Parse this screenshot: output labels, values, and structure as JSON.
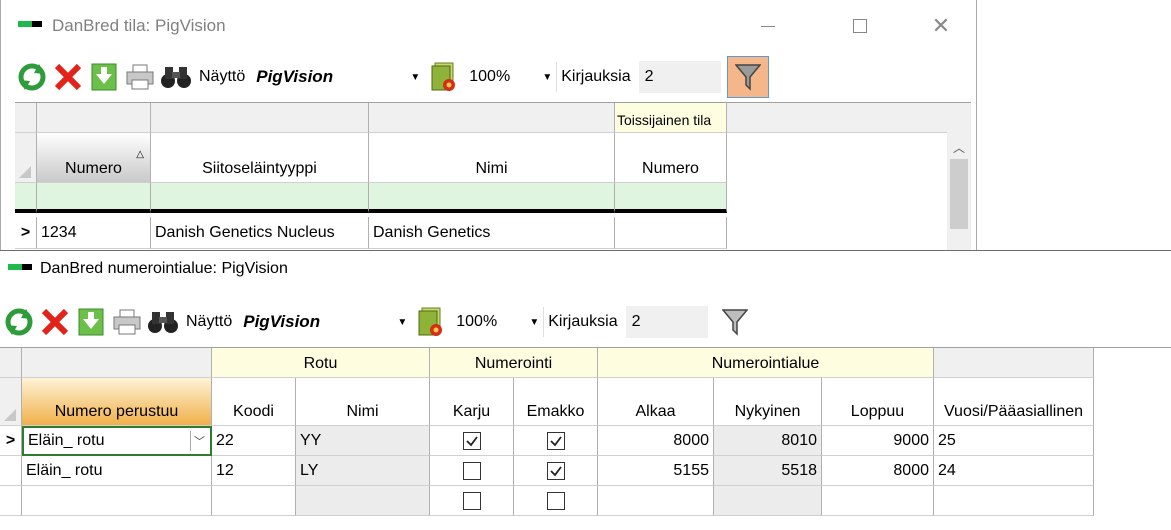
{
  "window1": {
    "title": "DanBred tila: PigVision",
    "toolbar": {
      "view_label": "Näyttö",
      "view_value": "PigVision",
      "zoom_value": "100%",
      "count_label": "Kirjauksia",
      "count_value": "2"
    },
    "grid": {
      "group_headers": {
        "secondary": "Toissijainen tila"
      },
      "columns": [
        "Numero",
        "Siitoseläintyyppi",
        "Nimi",
        "Numero"
      ],
      "rows": [
        {
          "marker": ">",
          "numero": "1234",
          "tyyppi": "Danish Genetics Nucleus",
          "nimi": "Danish Genetics",
          "numero2": ""
        }
      ]
    }
  },
  "window2": {
    "title": "DanBred numerointialue: PigVision",
    "toolbar": {
      "view_label": "Näyttö",
      "view_value": "PigVision",
      "zoom_value": "100%",
      "count_label": "Kirjauksia",
      "count_value": "2"
    },
    "grid": {
      "group_headers": {
        "rotu": "Rotu",
        "numerointi": "Numerointi",
        "numerointialue": "Numerointialue"
      },
      "columns": [
        "Numero perustuu",
        "Koodi",
        "Nimi",
        "Karju",
        "Emakko",
        "Alkaa",
        "Nykyinen",
        "Loppuu",
        "Vuosi/Pääasiallinen"
      ],
      "rows": [
        {
          "marker": ">",
          "perustuu": "Eläin_ rotu",
          "koodi": "22",
          "nimi": "YY",
          "karju": true,
          "emakko": true,
          "alkaa": "8000",
          "nykyinen": "8010",
          "loppuu": "9000",
          "vuosi": "25"
        },
        {
          "marker": "",
          "perustuu": "Eläin_ rotu",
          "koodi": "12",
          "nimi": "LY",
          "karju": false,
          "emakko": true,
          "alkaa": "5155",
          "nykyinen": "5518",
          "loppuu": "8000",
          "vuosi": "24"
        },
        {
          "marker": "",
          "perustuu": "",
          "koodi": "",
          "nimi": "",
          "karju": false,
          "emakko": false,
          "alkaa": "",
          "nykyinen": "",
          "loppuu": "",
          "vuosi": ""
        }
      ]
    }
  },
  "colors": {
    "sorted_header": "#c9c9c9",
    "active_header": "#f0b04a",
    "group_header": "#fefde0",
    "filter_active": "#f5b78a",
    "new_row": "#dff5df"
  },
  "icons": [
    "refresh-icon",
    "delete-icon",
    "export-icon",
    "print-icon",
    "binoculars-icon",
    "report-icon",
    "filter-icon"
  ]
}
